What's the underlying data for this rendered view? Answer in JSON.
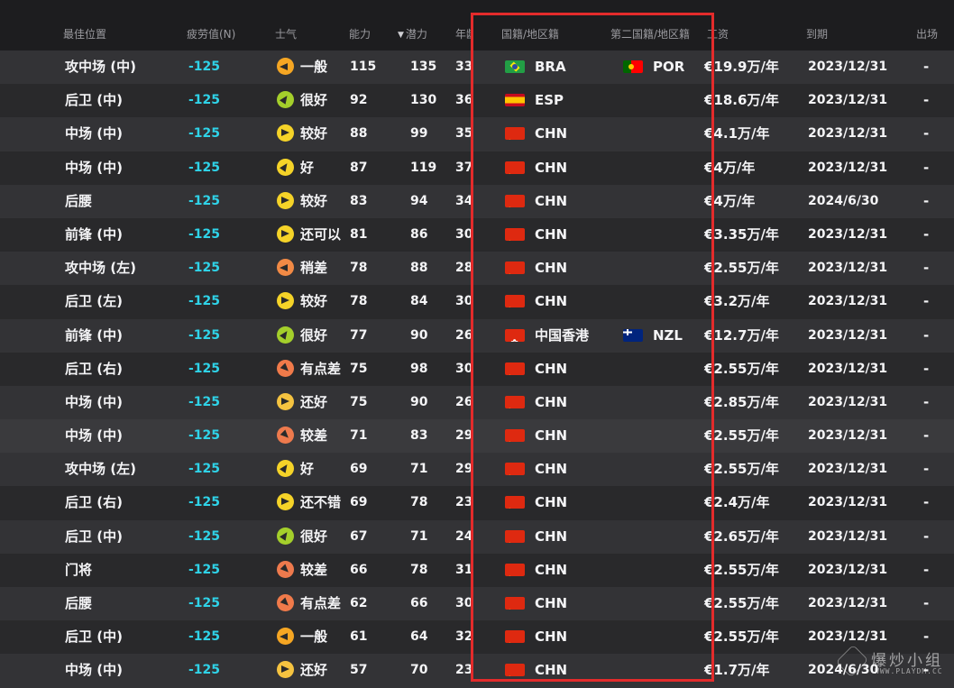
{
  "columns": {
    "position": "最佳位置",
    "fatigue": "疲劳值(N)",
    "morale": "士气",
    "ability": "能力",
    "potential": "潜力",
    "age": "年龄",
    "nationality": "国籍/地区籍",
    "second_nationality": "第二国籍/地区籍",
    "wage": "工资",
    "expiry": "到期",
    "appearances": "出场"
  },
  "sort": {
    "column": "potential",
    "direction": "descending",
    "icon": "sort-down-icon"
  },
  "highlight": {
    "color": "#e32b2b",
    "columns": [
      "nationality",
      "second_nationality"
    ]
  },
  "morale_colors": {
    "很好": "#a4cf2b",
    "好": "#f5d328",
    "较好": "#f5d328",
    "还可以": "#f5d328",
    "还不错": "#f5d328",
    "还好": "#f5c340",
    "一般": "#f5a623",
    "稍差": "#f28a45",
    "有点差": "#f07a4a",
    "较差": "#ee7a4d"
  },
  "rows": [
    {
      "position": "攻中场 (中)",
      "fatigue": "-125",
      "morale": "一般",
      "morale_dir": "left",
      "ability": "115",
      "potential": "135",
      "age": "33",
      "nat_flag": "BRA",
      "nat": "BRA",
      "nat2_flag": "POR",
      "nat2": "POR",
      "wage": "€19.9万/年",
      "expiry": "2023/12/31",
      "apps": "-"
    },
    {
      "position": "后卫 (中)",
      "fatigue": "-125",
      "morale": "很好",
      "morale_dir": "up",
      "ability": "92",
      "potential": "130",
      "age": "36",
      "nat_flag": "ESP",
      "nat": "ESP",
      "nat2_flag": "",
      "nat2": "",
      "wage": "€18.6万/年",
      "expiry": "2023/12/31",
      "apps": "-"
    },
    {
      "position": "中场 (中)",
      "fatigue": "-125",
      "morale": "较好",
      "morale_dir": "right",
      "ability": "88",
      "potential": "99",
      "age": "35",
      "nat_flag": "CHN",
      "nat": "CHN",
      "nat2_flag": "",
      "nat2": "",
      "wage": "€4.1万/年",
      "expiry": "2023/12/31",
      "apps": "-"
    },
    {
      "position": "中场 (中)",
      "fatigue": "-125",
      "morale": "好",
      "morale_dir": "up",
      "ability": "87",
      "potential": "119",
      "age": "37",
      "nat_flag": "CHN",
      "nat": "CHN",
      "nat2_flag": "",
      "nat2": "",
      "wage": "€4万/年",
      "expiry": "2023/12/31",
      "apps": "-"
    },
    {
      "position": "后腰",
      "fatigue": "-125",
      "morale": "较好",
      "morale_dir": "right",
      "ability": "83",
      "potential": "94",
      "age": "34",
      "nat_flag": "CHN",
      "nat": "CHN",
      "nat2_flag": "",
      "nat2": "",
      "wage": "€4万/年",
      "expiry": "2024/6/30",
      "apps": "-"
    },
    {
      "position": "前锋 (中)",
      "fatigue": "-125",
      "morale": "还可以",
      "morale_dir": "right",
      "ability": "81",
      "potential": "86",
      "age": "30",
      "nat_flag": "CHN",
      "nat": "CHN",
      "nat2_flag": "",
      "nat2": "",
      "wage": "€3.35万/年",
      "expiry": "2023/12/31",
      "apps": "-"
    },
    {
      "position": "攻中场 (左)",
      "fatigue": "-125",
      "morale": "稍差",
      "morale_dir": "left",
      "ability": "78",
      "potential": "88",
      "age": "28",
      "nat_flag": "CHN",
      "nat": "CHN",
      "nat2_flag": "",
      "nat2": "",
      "wage": "€2.55万/年",
      "expiry": "2023/12/31",
      "apps": "-"
    },
    {
      "position": "后卫 (左)",
      "fatigue": "-125",
      "morale": "较好",
      "morale_dir": "right",
      "ability": "78",
      "potential": "84",
      "age": "30",
      "nat_flag": "CHN",
      "nat": "CHN",
      "nat2_flag": "",
      "nat2": "",
      "wage": "€3.2万/年",
      "expiry": "2023/12/31",
      "apps": "-"
    },
    {
      "position": "前锋 (中)",
      "fatigue": "-125",
      "morale": "很好",
      "morale_dir": "up",
      "ability": "77",
      "potential": "90",
      "age": "26",
      "nat_flag": "HKG",
      "nat": "中国香港",
      "nat2_flag": "NZL",
      "nat2": "NZL",
      "wage": "€12.7万/年",
      "expiry": "2023/12/31",
      "apps": "-"
    },
    {
      "position": "后卫 (右)",
      "fatigue": "-125",
      "morale": "有点差",
      "morale_dir": "down",
      "ability": "75",
      "potential": "98",
      "age": "30",
      "nat_flag": "CHN",
      "nat": "CHN",
      "nat2_flag": "",
      "nat2": "",
      "wage": "€2.55万/年",
      "expiry": "2023/12/31",
      "apps": "-"
    },
    {
      "position": "中场 (中)",
      "fatigue": "-125",
      "morale": "还好",
      "morale_dir": "right",
      "ability": "75",
      "potential": "90",
      "age": "26",
      "nat_flag": "CHN",
      "nat": "CHN",
      "nat2_flag": "",
      "nat2": "",
      "wage": "€2.85万/年",
      "expiry": "2023/12/31",
      "apps": "-"
    },
    {
      "position": "中场 (中)",
      "fatigue": "-125",
      "morale": "较差",
      "morale_dir": "down",
      "ability": "71",
      "potential": "83",
      "age": "29",
      "nat_flag": "CHN",
      "nat": "CHN",
      "nat2_flag": "",
      "nat2": "",
      "wage": "€2.55万/年",
      "expiry": "2023/12/31",
      "apps": "-"
    },
    {
      "position": "攻中场 (左)",
      "fatigue": "-125",
      "morale": "好",
      "morale_dir": "up",
      "ability": "69",
      "potential": "71",
      "age": "29",
      "nat_flag": "CHN",
      "nat": "CHN",
      "nat2_flag": "",
      "nat2": "",
      "wage": "€2.55万/年",
      "expiry": "2023/12/31",
      "apps": "-"
    },
    {
      "position": "后卫 (右)",
      "fatigue": "-125",
      "morale": "还不错",
      "morale_dir": "right",
      "ability": "69",
      "potential": "78",
      "age": "23",
      "nat_flag": "CHN",
      "nat": "CHN",
      "nat2_flag": "",
      "nat2": "",
      "wage": "€2.4万/年",
      "expiry": "2023/12/31",
      "apps": "-"
    },
    {
      "position": "后卫 (中)",
      "fatigue": "-125",
      "morale": "很好",
      "morale_dir": "up",
      "ability": "67",
      "potential": "71",
      "age": "24",
      "nat_flag": "CHN",
      "nat": "CHN",
      "nat2_flag": "",
      "nat2": "",
      "wage": "€2.65万/年",
      "expiry": "2023/12/31",
      "apps": "-"
    },
    {
      "position": "门将",
      "fatigue": "-125",
      "morale": "较差",
      "morale_dir": "down",
      "ability": "66",
      "potential": "78",
      "age": "31",
      "nat_flag": "CHN",
      "nat": "CHN",
      "nat2_flag": "",
      "nat2": "",
      "wage": "€2.55万/年",
      "expiry": "2023/12/31",
      "apps": "-"
    },
    {
      "position": "后腰",
      "fatigue": "-125",
      "morale": "有点差",
      "morale_dir": "down",
      "ability": "62",
      "potential": "66",
      "age": "30",
      "nat_flag": "CHN",
      "nat": "CHN",
      "nat2_flag": "",
      "nat2": "",
      "wage": "€2.55万/年",
      "expiry": "2023/12/31",
      "apps": "-"
    },
    {
      "position": "后卫 (中)",
      "fatigue": "-125",
      "morale": "一般",
      "morale_dir": "left",
      "ability": "61",
      "potential": "64",
      "age": "32",
      "nat_flag": "CHN",
      "nat": "CHN",
      "nat2_flag": "",
      "nat2": "",
      "wage": "€2.55万/年",
      "expiry": "2023/12/31",
      "apps": "-"
    },
    {
      "position": "中场 (中)",
      "fatigue": "-125",
      "morale": "还好",
      "morale_dir": "right",
      "ability": "57",
      "potential": "70",
      "age": "23",
      "nat_flag": "CHN",
      "nat": "CHN",
      "nat2_flag": "",
      "nat2": "",
      "wage": "€1.7万/年",
      "expiry": "2024/6/30",
      "apps": "-"
    }
  ],
  "watermark": {
    "text": "爆炒小组",
    "sub": "WWW.PLAYDM.CC",
    "icon": "watermark-emblem-icon"
  }
}
